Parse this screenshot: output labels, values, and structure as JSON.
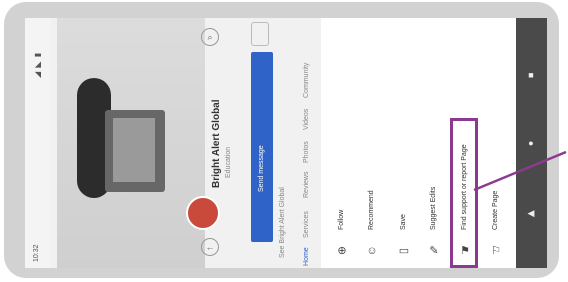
{
  "status": {
    "time": "10:32",
    "signal": "◢ ◣ ▮"
  },
  "page": {
    "name": "Bright Alert Global",
    "category": "Education",
    "message_label": "Send message",
    "tabs": [
      "Home",
      "Services",
      "Reviews",
      "Photos",
      "Videos",
      "Community"
    ],
    "section_label": "See Bright Alert Global"
  },
  "menu": {
    "items": [
      {
        "label": "Follow",
        "icon": "⊕"
      },
      {
        "label": "Recommend",
        "icon": "☺"
      },
      {
        "label": "Save",
        "icon": "▭"
      },
      {
        "label": "Suggest Edits",
        "icon": "✎"
      },
      {
        "label": "Find support or report Page",
        "icon": "⚑"
      },
      {
        "label": "Create Page",
        "icon": "⚐"
      }
    ]
  },
  "colors": {
    "highlight": "#8b3a8f",
    "accent": "#2f63c8",
    "navbar": "#4a4a4a"
  },
  "navbar": {
    "icons": [
      "recent-apps-icon",
      "home-icon",
      "back-icon"
    ]
  }
}
